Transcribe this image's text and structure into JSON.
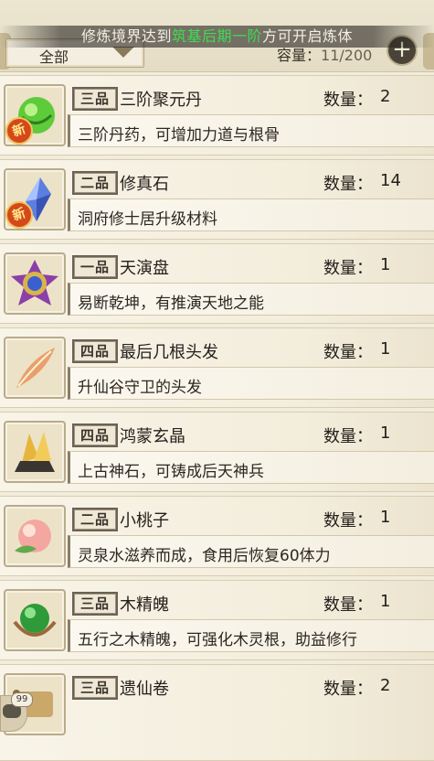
{
  "notice": {
    "before": "修炼境界达到",
    "highlight": "筑基后期一阶",
    "after": "方可开启炼体",
    "highlight_color": "#3fdc4f"
  },
  "filter": {
    "label": "全部",
    "icon": "chevron-down-icon"
  },
  "capacity": {
    "label": "容量：",
    "value": "11/200"
  },
  "add_button": {
    "icon": "plus-icon",
    "symbol": "+"
  },
  "qty_label": "数量：",
  "items": [
    {
      "grade": "三品",
      "name": "三阶聚元丹",
      "qty": "2",
      "desc": "三阶丹药，可增加力道与根骨",
      "icon": "green-pill-icon",
      "is_new": true,
      "new_label": "新"
    },
    {
      "grade": "二品",
      "name": "修真石",
      "qty": "14",
      "desc": "洞府修士居升级材料",
      "icon": "blue-crystal-icon",
      "is_new": true,
      "new_label": "新"
    },
    {
      "grade": "一品",
      "name": "天演盘",
      "qty": "1",
      "desc": "易断乾坤，有推演天地之能",
      "icon": "purple-disc-icon",
      "is_new": false
    },
    {
      "grade": "四品",
      "name": "最后几根头发",
      "qty": "1",
      "desc": "升仙谷守卫的头发",
      "icon": "feather-hair-icon",
      "is_new": false
    },
    {
      "grade": "四品",
      "name": "鸿蒙玄晶",
      "qty": "1",
      "desc": "上古神石，可铸成后天神兵",
      "icon": "gold-crystal-icon",
      "is_new": false
    },
    {
      "grade": "二品",
      "name": "小桃子",
      "qty": "1",
      "desc": "灵泉水滋养而成，食用后恢复60体力",
      "icon": "peach-icon",
      "is_new": false
    },
    {
      "grade": "三品",
      "name": "木精魄",
      "qty": "1",
      "desc": "五行之木精魄，可强化木灵根，助益修行",
      "icon": "green-orb-icon",
      "is_new": false
    },
    {
      "grade": "三品",
      "name": "遗仙卷",
      "qty": "2",
      "desc": "",
      "icon": "scroll-icon",
      "is_new": false
    }
  ],
  "chat": {
    "badge": "99",
    "icon": "chat-icon"
  }
}
